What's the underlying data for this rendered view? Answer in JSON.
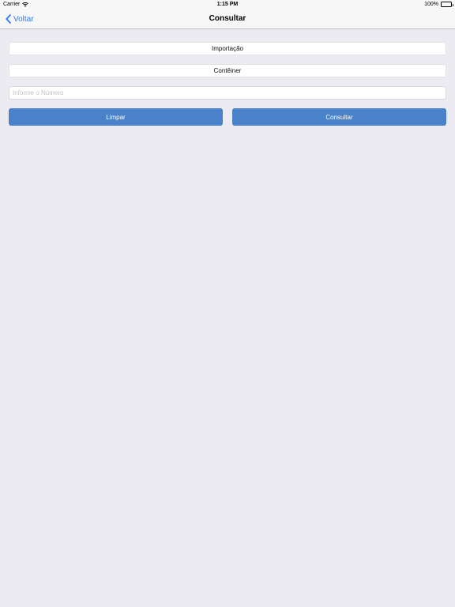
{
  "status_bar": {
    "carrier": "Carrier",
    "time": "1:15 PM",
    "battery": "100%"
  },
  "nav": {
    "back_label": "Voltar",
    "title": "Consultar"
  },
  "form": {
    "type_selector": "Importação",
    "category_selector": "Contêiner",
    "number_placeholder": "Informe o Número",
    "number_value": ""
  },
  "buttons": {
    "clear_label": "Limpar",
    "search_label": "Consultar"
  },
  "colors": {
    "accent": "#2e7cf6",
    "button": "#4a82c9",
    "background": "#ebebf1"
  }
}
